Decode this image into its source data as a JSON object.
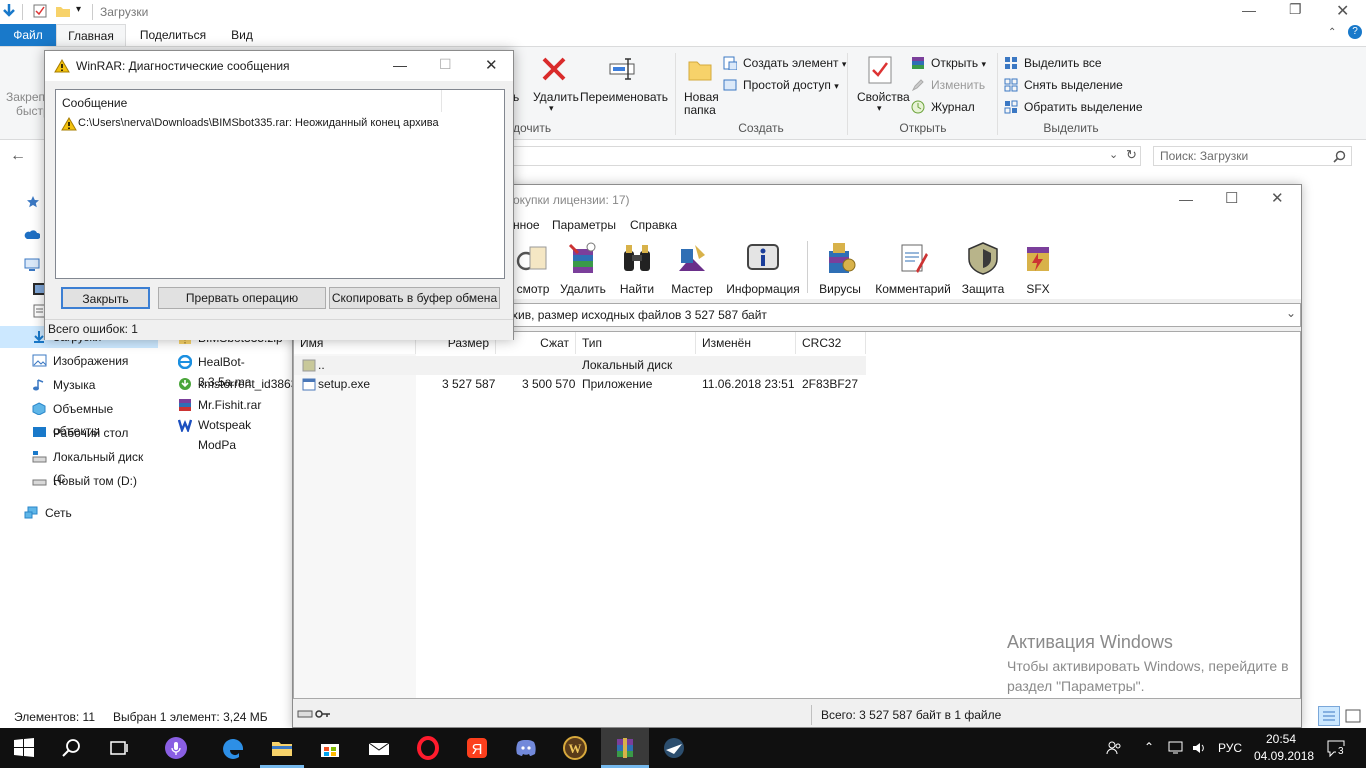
{
  "explorer": {
    "title": "Загрузки",
    "tabs": {
      "file": "Файл",
      "home": "Главная",
      "share": "Поделиться",
      "view": "Вид"
    },
    "ribbon": {
      "clip_label_1": "Закрепи",
      "clip_label_2": "быстр",
      "delete": "Удалить",
      "rename": "Переименовать",
      "organize_label": "дочить",
      "new_folder_1": "Новая",
      "new_folder_2": "папка",
      "create_element": "Создать элемент",
      "easy_access": "Простой доступ",
      "create_group": "Создать",
      "properties": "Свойства",
      "open": "Открыть",
      "edit": "Изменить",
      "history": "Журнал",
      "open_group": "Открыть",
      "select_all": "Выделить все",
      "select_none": "Снять выделение",
      "invert_selection": "Обратить выделение",
      "select_group": "Выделить"
    },
    "search_placeholder": "Поиск: Загрузки",
    "nav": [
      {
        "label": "Загрузки",
        "icon": "download-icon"
      },
      {
        "label": "Изображения",
        "icon": "images-icon"
      },
      {
        "label": "Музыка",
        "icon": "music-icon"
      },
      {
        "label": "Объемные объекты",
        "icon": "3d-objects-icon"
      },
      {
        "label": "Рабочий стол",
        "icon": "desktop-icon"
      },
      {
        "label": "Локальный диск (С",
        "icon": "drive-icon"
      },
      {
        "label": "Новый том (D:)",
        "icon": "drive-icon"
      },
      {
        "label": "Сеть",
        "icon": "network-icon"
      }
    ],
    "files": [
      {
        "label": "BIMSbot335.zip",
        "icon": "zip-icon"
      },
      {
        "label": "HealBot-3.3.5a.ma",
        "icon": "ie-file-icon"
      },
      {
        "label": "kmstorrent_id3863",
        "icon": "torrent-file-icon"
      },
      {
        "label": "Mr.Fishit.rar",
        "icon": "rar-file-icon"
      },
      {
        "label": "Wotspeak ModPa",
        "icon": "w-file-icon"
      }
    ],
    "status": {
      "count": "Элементов: 11",
      "selected": "Выбран 1 элемент: 3,24 МБ"
    }
  },
  "rar": {
    "title": "окупки лицензии: 17)",
    "menu": [
      "нное",
      "Параметры",
      "Справка"
    ],
    "tools": [
      {
        "label": "смотр",
        "icon": "view-icon"
      },
      {
        "label": "Удалить",
        "icon": "delete-icon"
      },
      {
        "label": "Найти",
        "icon": "find-icon"
      },
      {
        "label": "Мастер",
        "icon": "wizard-icon"
      },
      {
        "label": "Информация",
        "icon": "info-icon"
      },
      {
        "label": "Вирусы",
        "icon": "virus-scan-icon"
      },
      {
        "label": "Комментарий",
        "icon": "comment-icon"
      },
      {
        "label": "Защита",
        "icon": "protect-icon"
      },
      {
        "label": "SFX",
        "icon": "sfx-icon"
      }
    ],
    "path": "хив, размер исходных файлов 3 527 587 байт",
    "columns": {
      "name": "Имя",
      "size": "Размер",
      "packed": "Сжат",
      "type": "Тип",
      "modified": "Изменён",
      "crc": "CRC32"
    },
    "rows": [
      {
        "name": "..",
        "size": "",
        "packed": "",
        "type": "Локальный диск",
        "modified": "",
        "crc": ""
      },
      {
        "name": "setup.exe",
        "size": "3 527 587",
        "packed": "3 500 570",
        "type": "Приложение",
        "modified": "11.06.2018 23:51",
        "crc": "2F83BF27"
      }
    ],
    "status_total": "Всего: 3 527 587 байт в 1 файле"
  },
  "dialog": {
    "title": "WinRAR: Диагностические сообщения",
    "column": "Сообщение",
    "message": "C:\\Users\\nerva\\Downloads\\BIMSbot335.rar: Неожиданный конец архива",
    "buttons": {
      "close": "Закрыть",
      "abort": "Прервать операцию",
      "copy": "Скопировать в буфер обмена"
    },
    "errors": "Всего ошибок: 1"
  },
  "watermark": {
    "line1": "Активация Windows",
    "line2": "Чтобы активировать Windows, перейдите в",
    "line3": "раздел \"Параметры\"."
  },
  "taskbar": {
    "lang": "РУС",
    "time": "20:54",
    "date": "04.09.2018",
    "notifications": "3"
  },
  "colors": {
    "accent": "#1979ca",
    "taskbar": "#101010"
  }
}
